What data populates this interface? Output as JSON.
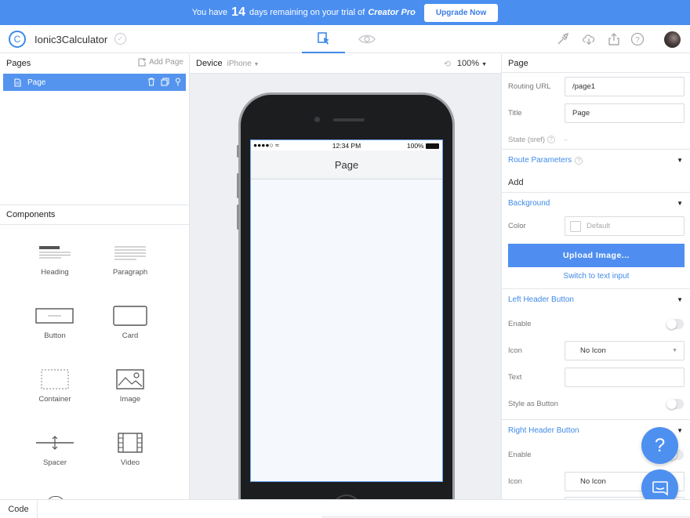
{
  "banner": {
    "prefix": "You have",
    "days": "14",
    "middle": "days remaining on your trial of",
    "product": "Creator Pro",
    "upgrade_label": "Upgrade Now"
  },
  "header": {
    "project_name": "Ionic3Calculator"
  },
  "pages_panel": {
    "title": "Pages",
    "add_label": "Add Page",
    "items": [
      {
        "label": "Page"
      }
    ]
  },
  "components_panel": {
    "title": "Components",
    "items": [
      {
        "label": "Heading"
      },
      {
        "label": "Paragraph"
      },
      {
        "label": "Button"
      },
      {
        "label": "Card"
      },
      {
        "label": "Container"
      },
      {
        "label": "Image"
      },
      {
        "label": "Spacer"
      },
      {
        "label": "Video"
      }
    ]
  },
  "canvas": {
    "device_label": "Device",
    "device_value": "iPhone",
    "zoom": "100%",
    "status_time": "12:34 PM",
    "status_battery": "100%",
    "page_title": "Page"
  },
  "properties": {
    "title": "Page",
    "routing_url_label": "Routing URL",
    "routing_url_value": "/page1",
    "title_label": "Title",
    "title_value": "Page",
    "state_label": "State (sref)",
    "state_value": "–",
    "route_params_section": "Route Parameters",
    "route_params_add": "Add",
    "background_section": "Background",
    "color_label": "Color",
    "color_placeholder": "Default",
    "upload_label": "Upload Image...",
    "switch_label": "Switch to text input",
    "left_header_section": "Left Header Button",
    "enable_label": "Enable",
    "icon_label": "Icon",
    "icon_value": "No Icon",
    "text_label": "Text",
    "style_button_label": "Style as Button",
    "right_header_section": "Right Header Button",
    "right_enable_label": "Enable",
    "right_icon_label": "Icon",
    "right_icon_value": "No Icon"
  },
  "help_label": "?",
  "bottom": {
    "code_tab": "Code"
  },
  "colors": {
    "accent": "#4a8ef0",
    "selection": "#5494ee"
  }
}
